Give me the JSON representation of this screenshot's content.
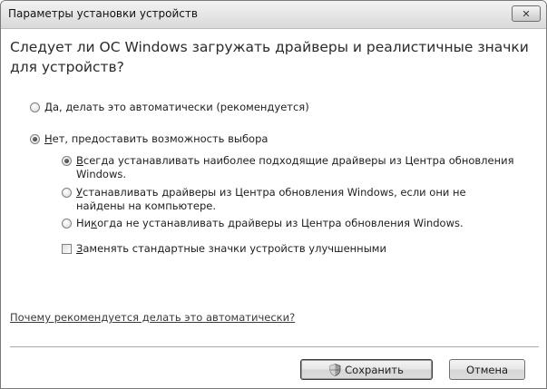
{
  "window": {
    "title": "Параметры установки устройств"
  },
  "heading": "Следует ли ОС Windows загружать драйверы и реалистичные значки для устройств?",
  "options": {
    "auto": {
      "hotkey": "Д",
      "rest": "а, делать это автоматически (рекомендуется)"
    },
    "manual": {
      "hotkey": "Н",
      "rest": "ет, предоставить возможность выбора"
    },
    "always": {
      "hotkey": "В",
      "rest": "сегда устанавливать наиболее подходящие драйверы из Центра обновления Windows."
    },
    "if_missing": {
      "hotkey": "У",
      "rest": "станавливать драйверы из Центра обновления Windows, если они не найдены на компьютере."
    },
    "never": {
      "pre": "Ни",
      "hotkey": "к",
      "rest": "огда не устанавливать драйверы из Центра обновления Windows."
    },
    "replace_icons": {
      "hotkey": "З",
      "rest": "аменять стандартные значки устройств улучшенными"
    }
  },
  "help_link": "Почему рекомендуется делать это автоматически?",
  "buttons": {
    "save": "Сохранить",
    "cancel": "Отмена"
  },
  "colors": {
    "titlebar_top": "#f3f3f3",
    "titlebar_bottom": "#d9d9d9",
    "heading_text": "#2b2b2b"
  }
}
